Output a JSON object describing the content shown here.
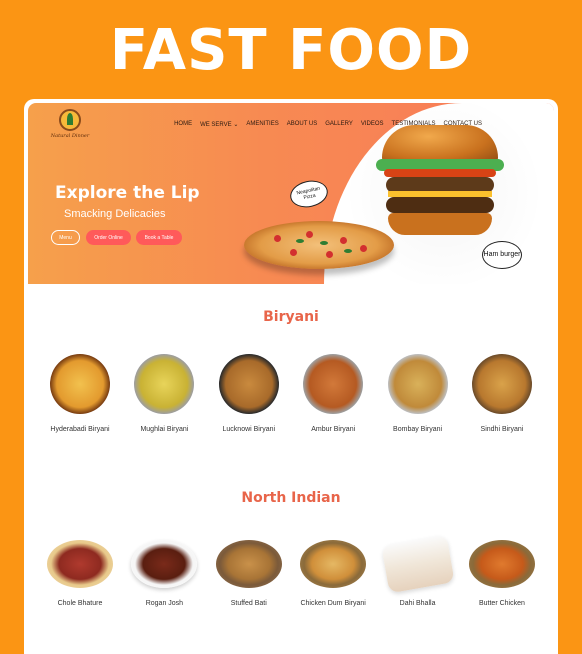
{
  "headline": "FAST FOOD",
  "site": {
    "logo_text": "Natural Dinner",
    "nav": [
      "HOME",
      "WE SERVE ⌄",
      "AMENITIES",
      "ABOUT US",
      "GALLERY",
      "VIDEOS",
      "TESTIMONIALS",
      "CONTACT US"
    ],
    "hero": {
      "title": "Explore the Lip",
      "subtitle": "Smacking Delicacies",
      "buttons": {
        "menu": "Menu",
        "order": "Order Online",
        "book": "Book a Table"
      },
      "bubble_pizza": "Neapolitan Pizza",
      "bubble_burger": "Ham burger"
    }
  },
  "sections": [
    {
      "title": "Biryani",
      "items": [
        "Hyderabadi Biryani",
        "Mughlai Biryani",
        "Lucknowi Biryani",
        "Ambur Biryani",
        "Bombay Biryani",
        "Sindhi Biryani"
      ]
    },
    {
      "title": "North Indian",
      "items": [
        "Chole Bhature",
        "Rogan Josh",
        "Stuffed Bati",
        "Chicken Dum Biryani",
        "Dahi Bhalla",
        "Butter Chicken"
      ]
    }
  ],
  "colors": {
    "background": "#FB9514",
    "accent": "#E8654A",
    "button": "#FF5A5A"
  }
}
